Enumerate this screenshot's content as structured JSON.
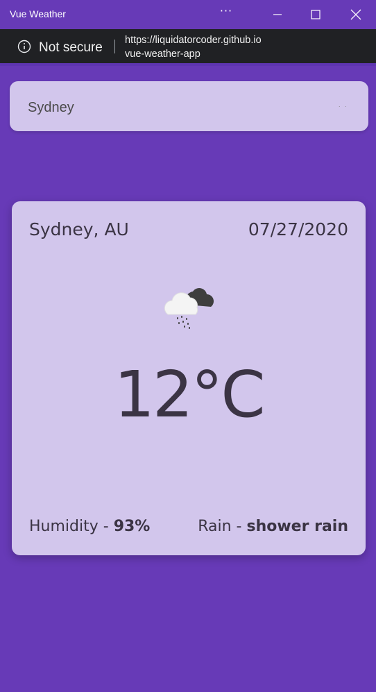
{
  "window": {
    "title": "Vue Weather",
    "more_icon": "more-horizontal-icon",
    "minimize_icon": "minimize-icon",
    "maximize_icon": "maximize-icon",
    "close_icon": "close-icon"
  },
  "address_bar": {
    "security_label": "Not secure",
    "url_line1": "https://liquidatorcoder.github.io",
    "url_line2": "vue-weather-app",
    "info_icon": "info-icon"
  },
  "search": {
    "value": "Sydney"
  },
  "weather": {
    "location": "Sydney, AU",
    "date": "07/27/2020",
    "icon": "shower-rain-icon",
    "temperature": "12°C",
    "humidity_label": "Humidity - ",
    "humidity_value": "93%",
    "rain_label": "Rain - ",
    "rain_value": "shower rain"
  },
  "colors": {
    "background": "#673ab7",
    "card": "#d2c6ec",
    "text": "#3b3444",
    "address_bar": "#202124"
  }
}
